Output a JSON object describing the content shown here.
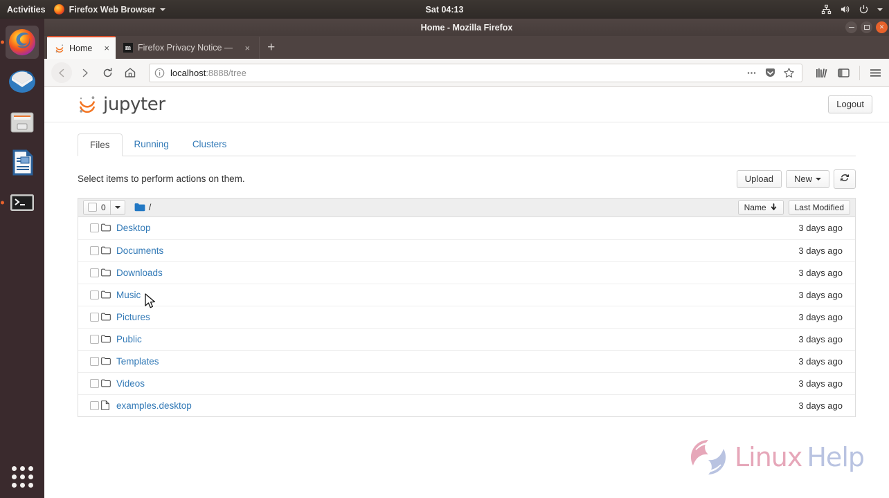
{
  "desktop": {
    "activities_label": "Activities",
    "app_menu_label": "Firefox Web Browser",
    "clock": "Sat 04:13",
    "tray_icons": [
      "network-icon",
      "volume-icon",
      "power-icon",
      "chevron-down-icon"
    ],
    "dock_items": [
      {
        "name": "dock-item-firefox",
        "label": "Firefox Web Browser"
      },
      {
        "name": "dock-item-thunderbird",
        "label": "Thunderbird Mail"
      },
      {
        "name": "dock-item-files",
        "label": "Files"
      },
      {
        "name": "dock-item-libreoffice-writer",
        "label": "LibreOffice Writer"
      },
      {
        "name": "dock-item-terminal",
        "label": "Terminal"
      }
    ],
    "show_apps_label": "Show Applications"
  },
  "browser": {
    "window_title": "Home - Mozilla Firefox",
    "window_buttons": [
      "minimize",
      "maximize",
      "close"
    ],
    "tabs": [
      {
        "title": "Home",
        "favicon": "jupyter-icon",
        "active": true,
        "close_label": "×"
      },
      {
        "title": "Firefox Privacy Notice —",
        "favicon": "mozilla-icon",
        "active": false,
        "close_label": "×"
      }
    ],
    "new_tab_label": "+",
    "nav": {
      "back_icon": "back-arrow-icon",
      "forward_icon": "forward-arrow-icon",
      "reload_icon": "reload-icon",
      "home_icon": "home-icon"
    },
    "url": {
      "host": "localhost",
      "path": ":8888/tree",
      "info_icon": "info-circle-icon",
      "page_actions_icon": "ellipsis-icon",
      "pocket_icon": "pocket-icon",
      "bookmark_icon": "star-icon"
    },
    "toolbar_right_icons": [
      "library-icon",
      "sidebar-icon",
      "hamburger-menu-icon"
    ]
  },
  "jupyter": {
    "brand": "jupyter",
    "logout_label": "Logout",
    "tabs": [
      {
        "label": "Files",
        "active": true
      },
      {
        "label": "Running",
        "active": false
      },
      {
        "label": "Clusters",
        "active": false
      }
    ],
    "action_text": "Select items to perform actions on them.",
    "upload_label": "Upload",
    "new_label": "New",
    "refresh_icon": "refresh-icon",
    "list_header": {
      "select_count": "0",
      "select_dropdown_icon": "caret-down-icon",
      "folder_icon": "folder-icon",
      "breadcrumb_path": "/",
      "sort_name_label": "Name",
      "sort_name_icon": "arrow-down-icon",
      "sort_modified_label": "Last Modified"
    },
    "files": [
      {
        "name": "Desktop",
        "type": "folder",
        "modified": "3 days ago"
      },
      {
        "name": "Documents",
        "type": "folder",
        "modified": "3 days ago"
      },
      {
        "name": "Downloads",
        "type": "folder",
        "modified": "3 days ago"
      },
      {
        "name": "Music",
        "type": "folder",
        "modified": "3 days ago"
      },
      {
        "name": "Pictures",
        "type": "folder",
        "modified": "3 days ago"
      },
      {
        "name": "Public",
        "type": "folder",
        "modified": "3 days ago"
      },
      {
        "name": "Templates",
        "type": "folder",
        "modified": "3 days ago"
      },
      {
        "name": "Videos",
        "type": "folder",
        "modified": "3 days ago"
      },
      {
        "name": "examples.desktop",
        "type": "file",
        "modified": "3 days ago"
      }
    ]
  },
  "watermark": {
    "text_primary": "Linux",
    "text_secondary": "Help",
    "color_primary": "#d7728f",
    "color_secondary": "#8fa0d0"
  },
  "colors": {
    "jupyter_orange": "#f37726",
    "link_blue": "#337ab7",
    "firefox_accent": "#d94f2b",
    "dock_background": "#3a2a2d"
  }
}
